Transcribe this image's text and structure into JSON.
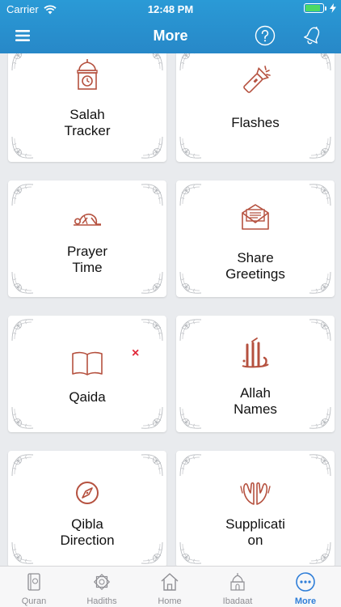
{
  "status": {
    "carrier": "Carrier",
    "time": "12:48 PM",
    "battery_level": 0.85
  },
  "nav": {
    "title": "More",
    "left_icon": "menu-icon",
    "right_icons": [
      "help-icon",
      "bell-icon"
    ]
  },
  "cards": [
    {
      "icon": "mosque-clock-icon",
      "label_lines": [
        "Salah",
        "Tracker"
      ]
    },
    {
      "icon": "flashlight-icon",
      "label_lines": [
        "Flashes"
      ]
    },
    {
      "icon": "prayer-prostration-icon",
      "label_lines": [
        "Prayer",
        "Time"
      ]
    },
    {
      "icon": "envelope-icon",
      "label_lines": [
        "Share",
        "Greetings"
      ]
    },
    {
      "icon": "book-icon",
      "label_lines": [
        "Qaida"
      ],
      "badge": "×"
    },
    {
      "icon": "allah-calligraphy-icon",
      "label_lines": [
        "Allah",
        "Names"
      ]
    },
    {
      "icon": "compass-icon",
      "label_lines": [
        "Qibla",
        "Direction"
      ]
    },
    {
      "icon": "praying-hands-icon",
      "label_lines": [
        "Supplicati",
        "on"
      ]
    }
  ],
  "tabs": [
    {
      "label": "Quran",
      "icon": "quran-icon",
      "active": false
    },
    {
      "label": "Hadiths",
      "icon": "hadith-star-icon",
      "active": false
    },
    {
      "label": "Home",
      "icon": "home-icon",
      "active": false
    },
    {
      "label": "Ibadaat",
      "icon": "mosque-icon",
      "active": false
    },
    {
      "label": "More",
      "icon": "more-icon",
      "active": true
    }
  ],
  "colors": {
    "header": "#2788c8",
    "icon_accent": "#b5513f",
    "active_tab": "#2f7ed8",
    "inactive_tab": "#8e8e93",
    "badge": "#e0293a"
  }
}
